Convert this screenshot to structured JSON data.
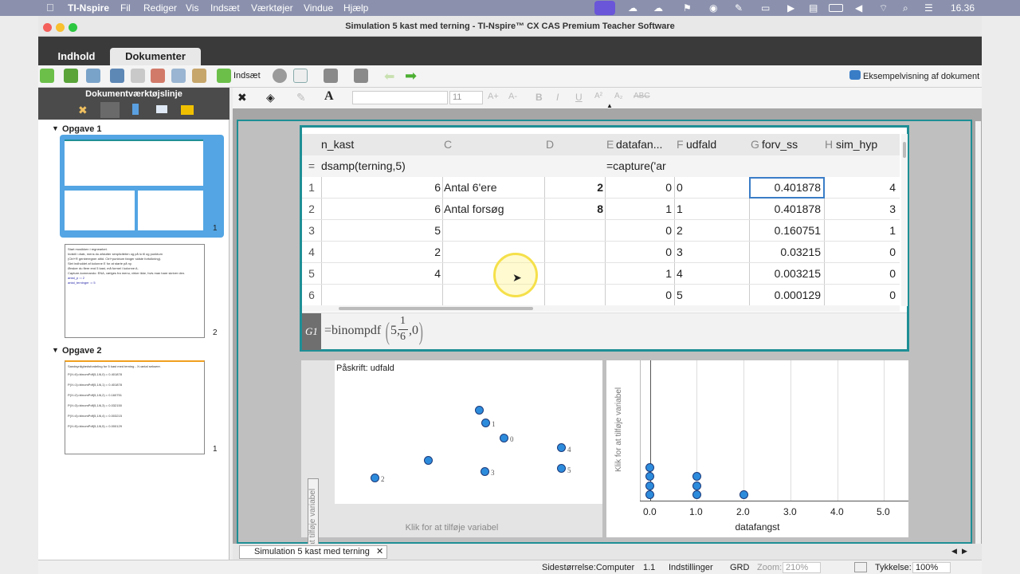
{
  "menubar": {
    "app": "TI-Nspire",
    "items": [
      "Fil",
      "Rediger",
      "Vis",
      "Indsæt",
      "Værktøjer",
      "Vindue",
      "Hjælp"
    ],
    "time": "16.36"
  },
  "window": {
    "title": "Simulation 5 kast med terning - TI-Nspire™ CX CAS Premium Teacher Software"
  },
  "tabs": {
    "content": "Indhold",
    "documents": "Dokumenter"
  },
  "toolbar": {
    "insert_label": "Indsæt",
    "preview_label": "Eksempelvisning af dokument",
    "font_size": "11"
  },
  "sidebar": {
    "title": "Dokumentværktøjslinje",
    "problem1": "Opgave 1",
    "problem2": "Opgave 2",
    "page1": "1",
    "page2": "2",
    "page3": "1",
    "thumb2_lines": [
      "Start musikken i regnearket.",
      "Indstil i drøk, mens du afslutter simpliciteten og på lo til og punktum",
      "(Ctrl+R genberegner altid. Ctrl+punktum fanger sidste fortolkning).",
      "Slet indholdet af kolonne E for at starte på ny.",
      "",
      "Ønsker du flere end 5 kast, må formel i kolonne A.",
      "Capture-kommando: ENA, vælges fra menu, virker ikke, hvis man bare skriver den.",
      "antal_p := 2",
      "antal_terninger := 5"
    ],
    "thumb3_lines": [
      "Sandsynlighedsfordeling for 5 kast med terning - X=antal seksere.",
      "P(X=0)=binomPdf(5,1/6,0) = 0.401878",
      "P(X=1)=binomPdf(5,1/6,1) = 0.401878",
      "P(X=2)=binomPdf(5,1/6,2) = 0.160751",
      "P(X=3)=binomPdf(5,1/6,3) = 0.032150",
      "P(X=4)=binomPdf(5,1/6,4) = 0.003215",
      "P(X=5)=binomPdf(5,1/6,5) = 0.000129"
    ]
  },
  "spreadsheet": {
    "headers": [
      {
        "letter": "",
        "name": "n_kast"
      },
      {
        "letter": "C",
        "name": ""
      },
      {
        "letter": "D",
        "name": ""
      },
      {
        "letter": "E",
        "name": "datafan..."
      },
      {
        "letter": "F",
        "name": "udfald"
      },
      {
        "letter": "G",
        "name": "forv_ss"
      },
      {
        "letter": "H",
        "name": "sim_hyp"
      }
    ],
    "formula_row": {
      "marker": "=",
      "b": "dsamp(terning,5)",
      "e": "=capture('ar"
    },
    "rows": [
      {
        "n": "1",
        "b": "6",
        "c": "Antal 6'ere",
        "d": "2",
        "e": "0",
        "f": "0",
        "g": "0.401878",
        "h": "4"
      },
      {
        "n": "2",
        "b": "6",
        "c": "Antal forsøg",
        "d": "8",
        "e": "1",
        "f": "1",
        "g": "0.401878",
        "h": "3"
      },
      {
        "n": "3",
        "b": "5",
        "c": "",
        "d": "",
        "e": "0",
        "f": "2",
        "g": "0.160751",
        "h": "1"
      },
      {
        "n": "4",
        "b": "2",
        "c": "",
        "d": "",
        "e": "0",
        "f": "3",
        "g": "0.03215",
        "h": "0"
      },
      {
        "n": "5",
        "b": "4",
        "c": "",
        "d": "",
        "e": "1",
        "f": "4",
        "g": "0.003215",
        "h": "0"
      },
      {
        "n": "6",
        "b": "",
        "c": "",
        "d": "",
        "e": "0",
        "f": "5",
        "g": "0.000129",
        "h": "0"
      }
    ],
    "entry_ref": "G1",
    "entry_formula": "=binompdf",
    "entry_args_pre": "5,",
    "entry_num": "1",
    "entry_den": "6",
    "entry_args_post": ",0"
  },
  "plot1": {
    "caption": "Påskrift: udfald",
    "xlabel": "Klik for at tilføje variabel",
    "ylabel": "Klik for at tilføje variabel",
    "point_labels": [
      "1",
      "0",
      "4",
      "5",
      "3",
      "2"
    ]
  },
  "plot2": {
    "ylabel": "Klik for at tilføje variabel",
    "xlabel": "datafangst",
    "ticks": [
      "0.0",
      "1.0",
      "2.0",
      "3.0",
      "4.0",
      "5.0"
    ]
  },
  "chart_data": {
    "type": "scatter",
    "xlabel": "datafangst",
    "ticks": [
      "0.0",
      "1.0",
      "2.0",
      "3.0",
      "4.0",
      "5.0"
    ],
    "dotplot_values": [
      0,
      0,
      0,
      0,
      1,
      1,
      1,
      2
    ]
  },
  "doctab": {
    "label": "Simulation 5 kast med terning"
  },
  "status": {
    "page_size": "Sidestørrelse:Computer",
    "page": "1.1",
    "settings": "Indstillinger",
    "angle": "GRD",
    "zoom_label": "Zoom:",
    "zoom": "210%",
    "thickness_label": "Tykkelse:",
    "thickness": "100%"
  }
}
